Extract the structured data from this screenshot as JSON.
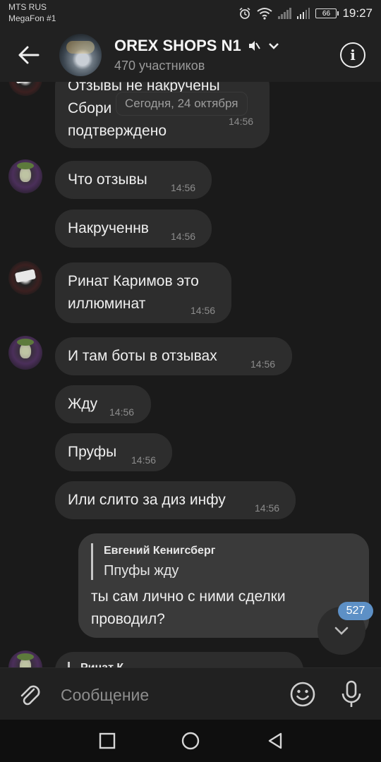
{
  "status_bar": {
    "carrier1": "MTS RUS",
    "carrier2": "MegaFon #1",
    "battery": "66",
    "time": "19:27",
    "icons": [
      "alarm-icon",
      "wifi-icon",
      "signal-icon",
      "signal-icon",
      "battery-icon"
    ]
  },
  "header": {
    "title": "OREX SHOPS N1",
    "subtitle": "470 участников",
    "icons": [
      "back-arrow-icon",
      "mute-icon",
      "chevron-down-icon",
      "info-icon"
    ]
  },
  "chat": {
    "date_divider": "Сегодня, 24 октября",
    "messages": [
      {
        "lines": [
          "Отзывы не накручены",
          "Сбори",
          "подтверждено"
        ],
        "time": "14:56",
        "avatar": "avatar-two"
      },
      {
        "lines": [
          "Что отзывы"
        ],
        "time": "14:56",
        "avatar": "avatar-joker"
      },
      {
        "lines": [
          "Накрученнв"
        ],
        "time": "14:56",
        "avatar": ""
      },
      {
        "lines": [
          "Ринат Каримов это",
          "иллюминат"
        ],
        "time": "14:56",
        "avatar": "avatar-two"
      },
      {
        "lines": [
          "И там боты в отзывах"
        ],
        "time": "14:56",
        "avatar": "avatar-joker"
      },
      {
        "lines": [
          "Жду"
        ],
        "time": "14:56",
        "avatar": ""
      },
      {
        "lines": [
          "Пруфы"
        ],
        "time": "14:56",
        "avatar": ""
      },
      {
        "lines": [
          "Или слито за диз инфу"
        ],
        "time": "14:56",
        "avatar": ""
      }
    ],
    "own_message": {
      "reply_author": "Евгений Кенигсберг",
      "reply_text": "Ппуфы жду",
      "lines": [
        "ты сам лично с ними сделки",
        "проводил?"
      ]
    },
    "partial_reply_author": "Ринат К...",
    "unread_count": "527"
  },
  "composer": {
    "placeholder": "Сообщение",
    "icons": [
      "attach-icon",
      "emoji-icon",
      "mic-icon"
    ]
  },
  "navbar": {
    "icons": [
      "recents-icon",
      "home-icon",
      "back-icon"
    ]
  }
}
